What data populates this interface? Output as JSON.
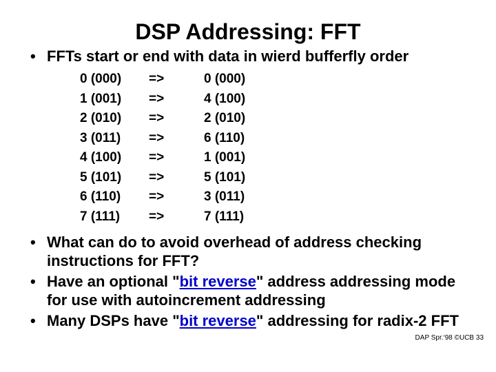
{
  "title": "DSP Addressing: FFT",
  "bullet_intro": "FFTs start or end with data in wierd bufferfly order",
  "mapping": [
    {
      "left": "0 (000)",
      "arrow": "=>",
      "right": "0 (000)"
    },
    {
      "left": "1 (001)",
      "arrow": "=>",
      "right": "4 (100)"
    },
    {
      "left": "2 (010)",
      "arrow": "=>",
      "right": "2 (010)"
    },
    {
      "left": "3 (011)",
      "arrow": "=>",
      "right": "6 (110)"
    },
    {
      "left": "4 (100)",
      "arrow": "=>",
      "right": "1 (001)"
    },
    {
      "left": "5 (101)",
      "arrow": "=>",
      "right": "5 (101)"
    },
    {
      "left": "6 (110)",
      "arrow": "=>",
      "right": "3 (011)"
    },
    {
      "left": "7 (111)",
      "arrow": "=>",
      "right": "7 (111)"
    }
  ],
  "bullet2": "What can do to avoid overhead of address checking instructions for FFT?",
  "bullet3_pre": "Have an optional \"",
  "bullet3_link": "bit reverse",
  "bullet3_post": "\" address addressing mode for use with autoincrement addressing",
  "bullet4_pre": "Many DSPs have \"",
  "bullet4_link": "bit reverse",
  "bullet4_post": "\" addressing for radix-2 FFT",
  "footer": "DAP Spr.‘98 ©UCB 33"
}
